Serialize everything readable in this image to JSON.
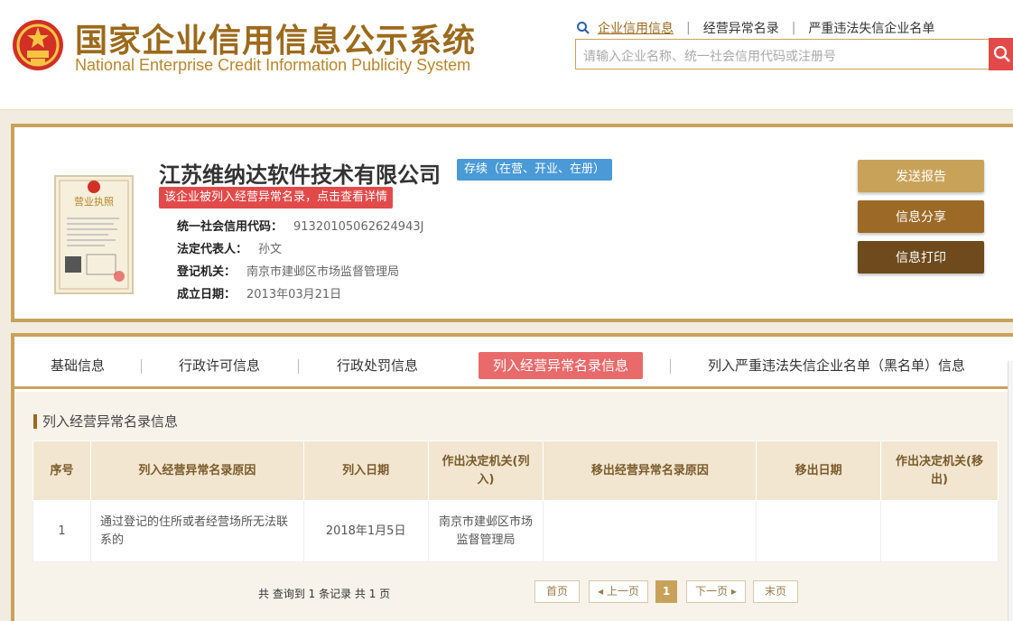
{
  "header": {
    "title_cn": "国家企业信用信息公示系统",
    "title_en": "National Enterprise Credit Information Publicity System",
    "nav": [
      "企业信用信息",
      "经营异常名录",
      "严重违法失信企业名单"
    ],
    "search_placeholder": "请输入企业名称、统一社会信用代码或注册号"
  },
  "company": {
    "name": "江苏维纳达软件技术有限公司",
    "status": "存续（在营、开业、在册）",
    "abnormal_notice": "该企业被列入经营异常名录，点击查看详情",
    "credit_code_label": "统一社会信用代码：",
    "credit_code": "91320105062624943J",
    "legal_rep_label": "法定代表人：",
    "legal_rep": "孙文",
    "authority_label": "登记机关：",
    "authority": "南京市建邺区市场监督管理局",
    "established_label": "成立日期：",
    "established": "2013年03月21日",
    "license_text": "营业执照"
  },
  "actions": {
    "report": "发送报告",
    "share": "信息分享",
    "print": "信息打印"
  },
  "tabs": [
    "基础信息",
    "行政许可信息",
    "行政处罚信息",
    "列入经营异常名录信息",
    "列入严重违法失信企业名单（黑名单）信息"
  ],
  "section": {
    "title": "列入经营异常名录信息",
    "columns": [
      "序号",
      "列入经营异常名录原因",
      "列入日期",
      "作出决定机关(列入)",
      "移出经营异常名录原因",
      "移出日期",
      "作出决定机关(移出)"
    ],
    "rows": [
      [
        "1",
        "通过登记的住所或者经营场所无法联系的",
        "2018年1月5日",
        "南京市建邺区市场监督管理局",
        "",
        "",
        ""
      ]
    ]
  },
  "pager": {
    "summary": "共 查询到 1 条记录 共 1 页",
    "first": "首页",
    "prev": "上一页",
    "current": "1",
    "next": "下一页",
    "last": "末页"
  },
  "colors": {
    "gold": "#c9a25a",
    "brown": "#9c6a26",
    "dark_brown": "#6e4a1c",
    "red": "#e24a4a",
    "blue": "#4a9ad8"
  }
}
